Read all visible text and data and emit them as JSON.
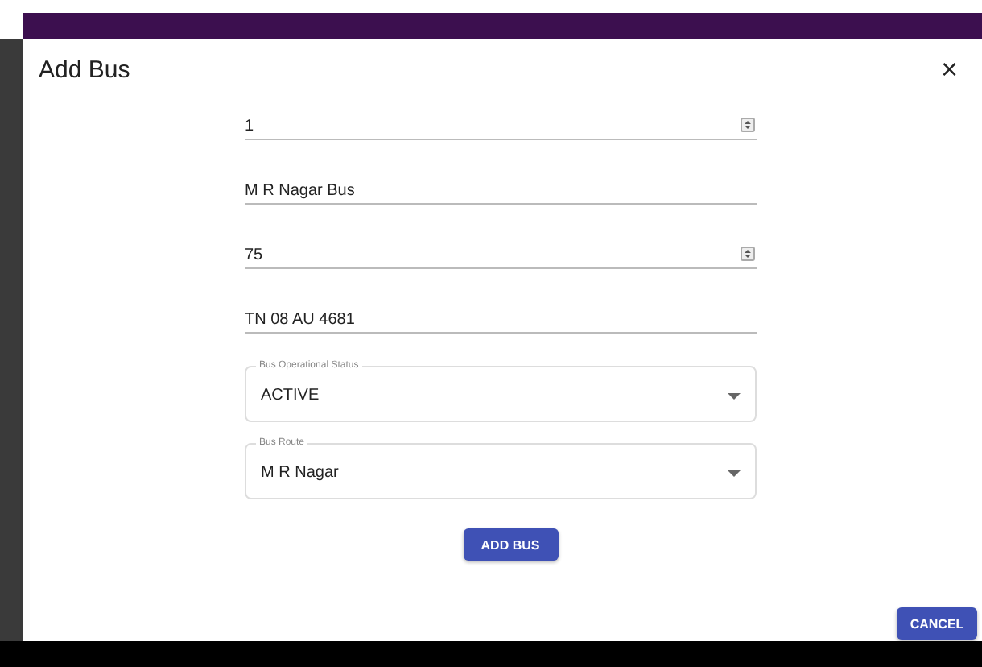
{
  "dialog": {
    "title": "Add Bus",
    "close": "×",
    "fields": [
      {
        "kind": "number",
        "value": "1"
      },
      {
        "kind": "text",
        "value": "M R Nagar Bus"
      },
      {
        "kind": "number",
        "value": "75"
      },
      {
        "kind": "text",
        "value": "TN 08 AU 4681"
      },
      {
        "kind": "select",
        "label": "Bus Operational Status",
        "value": "ACTIVE"
      },
      {
        "kind": "select",
        "label": "Bus Route",
        "value": "M R Nagar"
      }
    ],
    "submit": "ADD BUS"
  },
  "cancel": "CANCEL"
}
